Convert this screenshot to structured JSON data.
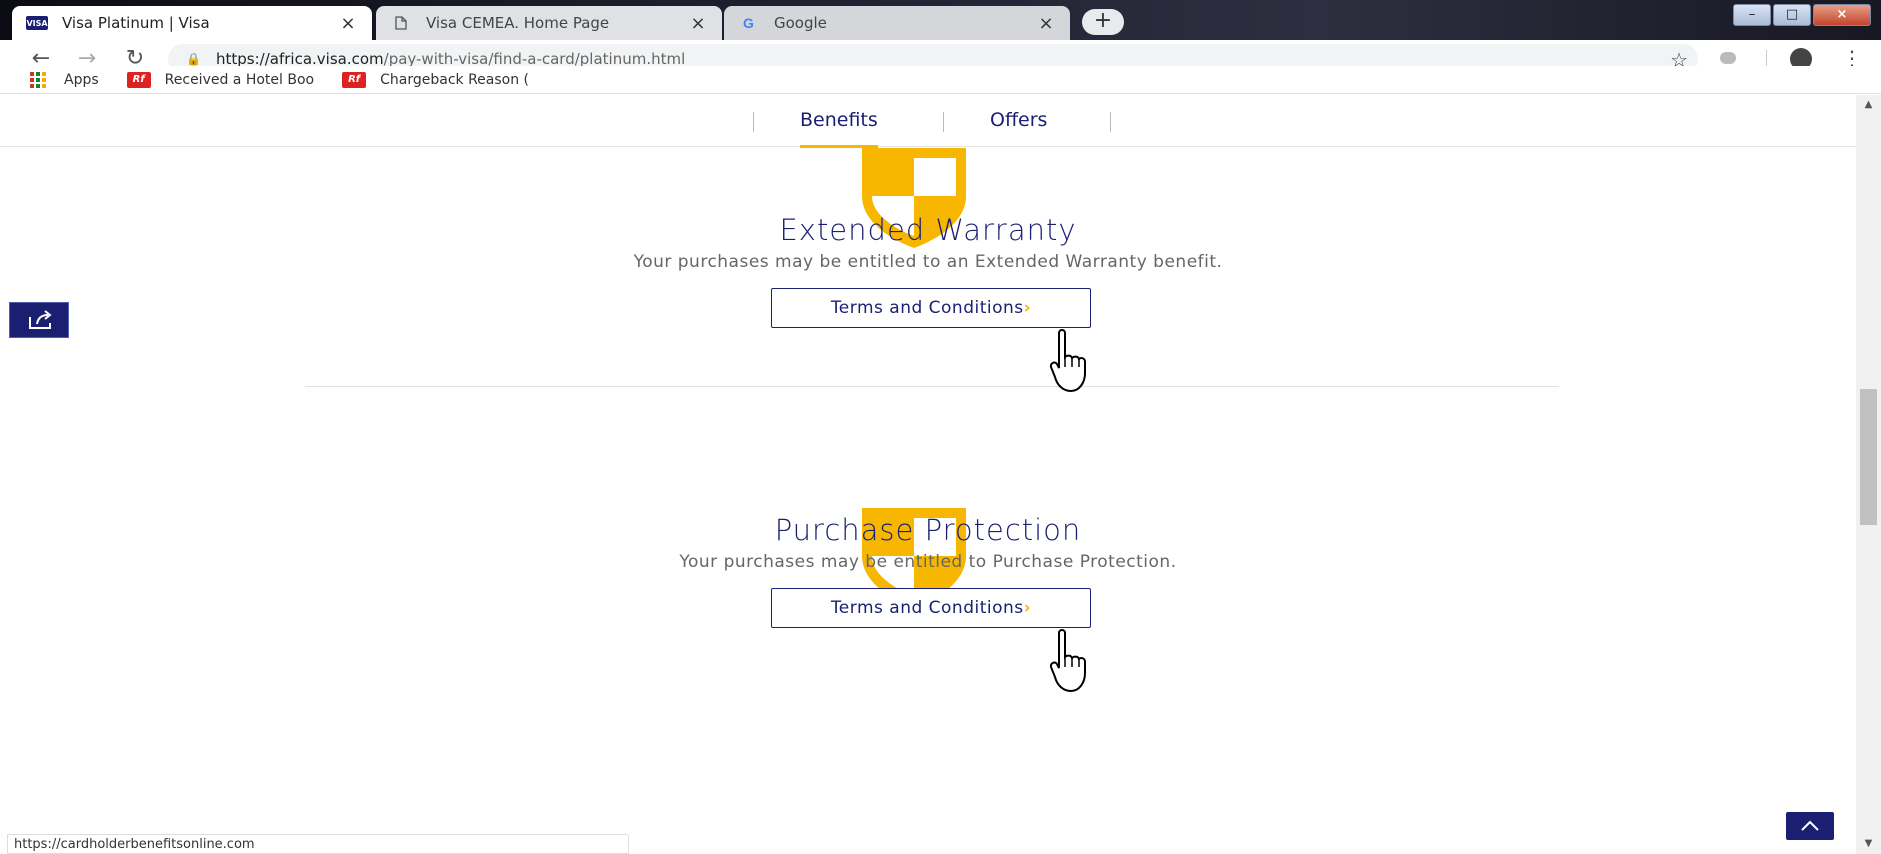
{
  "browser": {
    "tabs": [
      {
        "title": "Visa Platinum | Visa",
        "favicon": "visa-icon",
        "active": true
      },
      {
        "title": "Visa CEMEA. Home Page",
        "favicon": "page-icon",
        "active": false
      },
      {
        "title": "Google",
        "favicon": "google-icon",
        "active": false
      }
    ],
    "new_tab_label": "+",
    "url_host": "https://africa.visa.com",
    "url_path": "/pay-with-visa/find-a-card/platinum.html",
    "bookmarks": [
      {
        "label": "Apps",
        "icon": "apps-grid-icon"
      },
      {
        "label": "Received a Hotel Boo",
        "icon": "ratefrog-icon"
      },
      {
        "label": "Chargeback Reason (",
        "icon": "ratefrog-icon"
      }
    ]
  },
  "subnav": {
    "benefits": "Benefits",
    "offers": "Offers"
  },
  "features": [
    {
      "title": "Extended Warranty",
      "description": "Your purchases may be entitled to an Extended Warranty benefit.",
      "button": "Terms and Conditions",
      "icon": "shield-icon"
    },
    {
      "title": "Purchase Protection",
      "description": "Your purchases may be entitled to Purchase Protection.",
      "button": "Terms and Conditions",
      "icon": "shield-icon"
    }
  ],
  "status_bar": {
    "hover_url": "https://cardholderbenefitsonline.com"
  },
  "colors": {
    "visa_blue": "#1a1f71",
    "visa_gold": "#f7b600"
  }
}
